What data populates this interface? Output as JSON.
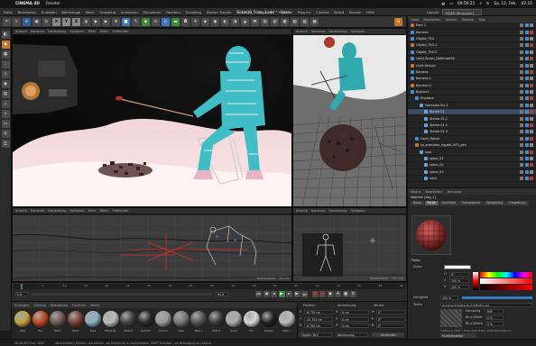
{
  "menubar": {
    "app": "CINEMA 4D",
    "items": [
      "Fenster"
    ],
    "right": {
      "time_left": "09:56:21",
      "date": "Sa. 12. Feb.",
      "time": "02:10"
    }
  },
  "c4dmenu": {
    "items": [
      "Datei",
      "Bearbeiten",
      "Erstellen",
      "Werkzeuge",
      "Mesh",
      "Snapping",
      "Animieren",
      "Simulieren",
      "Rendern",
      "Sculpting",
      "Motion Tracker",
      "MoGraph",
      "Charakter",
      "Pipeline",
      "Plug-ins",
      "Cinema",
      "Skript",
      "Fenster",
      "Hilfe"
    ],
    "title": "Ticket10_Polar_3.c4d * - Basis",
    "layout_label": "Layout:",
    "layout_value": "RS4R (Benutzer)"
  },
  "toolbar": {
    "undo": "↶",
    "axes": [
      "X",
      "Y",
      "Z"
    ]
  },
  "viewports": {
    "top_left": {
      "menus": [
        "Ansicht",
        "Kameras",
        "Darstellung",
        "Optionen",
        "Filter",
        "Tafeln",
        "ProRender"
      ],
      "label": "Perspektive"
    },
    "top_right": {
      "menus": [
        "Ansicht",
        "Kameras",
        "Darstellung",
        "Optionen",
        "Filter",
        "Tafeln",
        "ProRender"
      ]
    },
    "bottom_left": {
      "menus": [
        "Ansicht",
        "Kameras",
        "Darstellung",
        "Optionen",
        "Filter",
        "Tafeln",
        "ProRender"
      ],
      "label": "Rechts",
      "footer": "Rasterweite : 10 cm"
    },
    "bottom_right": {
      "menus": [
        "Ansicht",
        "Kameras",
        "Darstellung",
        "Optionen"
      ],
      "label": "Vorne",
      "footer": "Rasterweite : 100 cm"
    }
  },
  "object_manager": {
    "menus": [
      "Datei",
      "Bearbeiten",
      "Ansicht",
      "Objekte",
      "Tags"
    ],
    "rows": [
      {
        "name": "Kam 1",
        "depth": 0
      },
      {
        "name": "Kamera",
        "depth": 0
      },
      {
        "name": "Objekt_T54",
        "depth": 0
      },
      {
        "name": "Objekt_T54.1",
        "depth": 0
      },
      {
        "name": "Objekt_T54.2",
        "depth": 0
      },
      {
        "name": "Land_Rover_Defender90",
        "depth": 0
      },
      {
        "name": "Licht Setup1",
        "depth": 0
      },
      {
        "name": "Kamera",
        "depth": 0
      },
      {
        "name": "Kamera.1",
        "depth": 0
      },
      {
        "name": "Kamera.2",
        "depth": 0
      },
      {
        "name": "Boston1",
        "depth": 0
      },
      {
        "name": "Eissteps",
        "depth": 1
      },
      {
        "name": "Formsatz Eis-1",
        "depth": 2
      },
      {
        "name": "Steine 01",
        "depth": 3
      },
      {
        "name": "Steine 01.1",
        "depth": 3
      },
      {
        "name": "Steine 01.2",
        "depth": 3
      },
      {
        "name": "Steine 01.3",
        "depth": 3
      },
      {
        "name": "Hoch_Rauch",
        "depth": 1
      },
      {
        "name": "rp_arandom_rigged_003_gen",
        "depth": 1
      },
      {
        "name": "root",
        "depth": 2
      },
      {
        "name": "spine_01",
        "depth": 3
      },
      {
        "name": "spine_02",
        "depth": 3
      },
      {
        "name": "spine_03",
        "depth": 3
      },
      {
        "name": "neck",
        "depth": 3
      }
    ]
  },
  "attributes": {
    "menus": [
      "Modus",
      "Bearbeiten",
      "Benutzer"
    ],
    "material_label": "Material [tag_1]",
    "tabs": [
      "Basis",
      "Farbe",
      "Leuchten",
      "Transparenz",
      "Spiegelung",
      "Umgebung",
      "Nebel",
      "Relief",
      "Normale",
      "Alpha",
      "Glühen",
      "Displacement",
      "Zuweisen"
    ],
    "section": "Farbe",
    "farbe_label": "Farbe",
    "h_label": "H",
    "h_value": "0°",
    "s_label": "S",
    "s_value": "100 %",
    "v_label": "V",
    "v_value": "100 %",
    "helligkeit_label": "Helligkeit",
    "helligkeit_value": "100 %",
    "textur_label": "Textur",
    "textur_value": "Quarzsand(Shutterstock/KEIO/P1).jpg",
    "sampling_label": "Sampling",
    "sampling_value": "MIP",
    "blur_offset_label": "Blur-Offset",
    "blur_offset_value": "0 %",
    "blur_staerke_label": "Blur-Stärke",
    "blur_staerke_value": "0 %",
    "aufloesung": "Auflösung 2048 x 2048, RGB (8 Bit), sRGB IEC61966-2.1",
    "multi_button": "Multibitmaster",
    "mischmodus_label": "Mischmodus",
    "mischmodus_value": "Normal"
  },
  "timeline": {
    "current": "0 B",
    "end": "90 B",
    "ticks": [
      "0",
      "5",
      "10",
      "15",
      "20",
      "25",
      "30",
      "35",
      "40",
      "45",
      "50",
      "55",
      "60",
      "65",
      "70",
      "75",
      "80",
      "85",
      "90"
    ]
  },
  "material_manager": {
    "menus": [
      "Erzeugen",
      "Cinema",
      "Bearbeiten",
      "Funktion",
      "Textur"
    ],
    "materials": [
      {
        "name": "Mat",
        "color": "#c8a040"
      },
      {
        "name": "Fire",
        "color": "#c04a20"
      },
      {
        "name": "Stein",
        "color": "#6a5a50"
      },
      {
        "name": "Rost",
        "color": "#7a4030"
      },
      {
        "name": "tesa",
        "color": "#8ab0c0"
      },
      {
        "name": "Pfahl_Ro",
        "color": "#bbbbbb"
      },
      {
        "name": "Metall",
        "color": "#444444"
      },
      {
        "name": "Gummi",
        "color": "#2a2a2a"
      },
      {
        "name": "Chrom",
        "color": "#999999"
      },
      {
        "name": "Glas",
        "color": "#777777"
      },
      {
        "name": "Mat.1",
        "color": "#555555"
      },
      {
        "name": "Mat.2",
        "color": "#3a3a3a"
      },
      {
        "name": "Sand",
        "color": "#aaaaaa"
      },
      {
        "name": "Eis",
        "color": "#d8d8d8"
      },
      {
        "name": "Körper",
        "color": "#222222"
      },
      {
        "name": "Mat.3",
        "color": "#bbbbbb"
      }
    ]
  },
  "coordinates": {
    "headers": [
      "Position",
      "Abmessung",
      "Winkel"
    ],
    "rows": [
      {
        "axis": "X",
        "pos": "-6.778 cm",
        "size": "0 cm",
        "rot": "0°",
        "rot_axis": "H"
      },
      {
        "axis": "Y",
        "pos": "-15.702 cm",
        "size": "0 cm",
        "rot": "0°",
        "rot_axis": "P"
      },
      {
        "axis": "Z",
        "pos": "-6.784 cm",
        "size": "0 cm",
        "rot": "0°",
        "rot_axis": "B"
      }
    ],
    "mode": "Objekt (Rel)",
    "size_mode": "Abmessung",
    "apply": "Anwenden"
  },
  "status": {
    "left": "00:00:45 Frea: 1825",
    "right": "Verschieben: Klicken und ziehen, um Elemente zu verschieben. SHIFT drücken, um Bewegung zu rastern."
  },
  "colors": {
    "accent_orange": "#c8752a",
    "selection": "#3b4c63",
    "red_axis": "#d03030"
  }
}
